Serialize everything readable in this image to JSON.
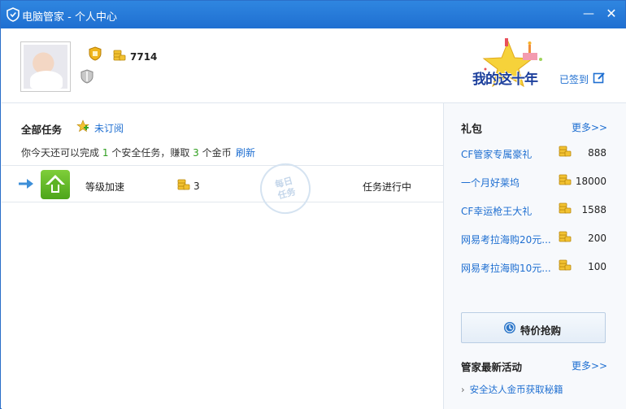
{
  "window": {
    "title": "电脑管家 - 个人中心",
    "min_glyph": "—",
    "close_glyph": "✕"
  },
  "profile": {
    "coins": "7714",
    "anniversary_text": "我的这十年",
    "signin_label": "已签到"
  },
  "tasks": {
    "section_title": "全部任务",
    "subscribe_label": "未订阅",
    "desc_prefix": "你今天还可以完成",
    "desc_count": "1",
    "desc_middle": "个安全任务，赚取",
    "desc_coins": "3",
    "desc_suffix": "个金币",
    "refresh_label": "刷新",
    "rows": [
      {
        "name": "等级加速",
        "reward": "3",
        "status": "任务进行中"
      }
    ],
    "stamp_line1": "每日",
    "stamp_line2": "任务"
  },
  "gifts": {
    "title": "礼包",
    "more_label": "更多>>",
    "items": [
      {
        "name": "CF管家专属豪礼",
        "value": "888"
      },
      {
        "name": "一个月好莱坞",
        "value": "18000"
      },
      {
        "name": "CF幸运枪王大礼",
        "value": "1588"
      },
      {
        "name": "网易考拉海购20元...",
        "value": "200"
      },
      {
        "name": "网易考拉海购10元...",
        "value": "100"
      }
    ],
    "buy_label": "特价抢购"
  },
  "activities": {
    "title": "管家最新活动",
    "more_label": "更多>>",
    "items": [
      {
        "label": "安全达人金币获取秘籍"
      }
    ]
  },
  "colors": {
    "titlebar": "#1f6fd1",
    "link": "#1f6fd1",
    "highlight_number": "#2f9e1f",
    "coin": "#e8b420"
  },
  "icons": {
    "app": "shield-icon",
    "coin": "coin-stack-icon",
    "gold_badge": "gold-shield-badge-icon",
    "gray_badge": "gray-shield-badge-icon",
    "edit": "edit-icon",
    "subscribe": "star-plus-icon",
    "arrow": "arrow-right-icon",
    "task": "level-up-arrow-icon",
    "clock": "clock-icon"
  }
}
